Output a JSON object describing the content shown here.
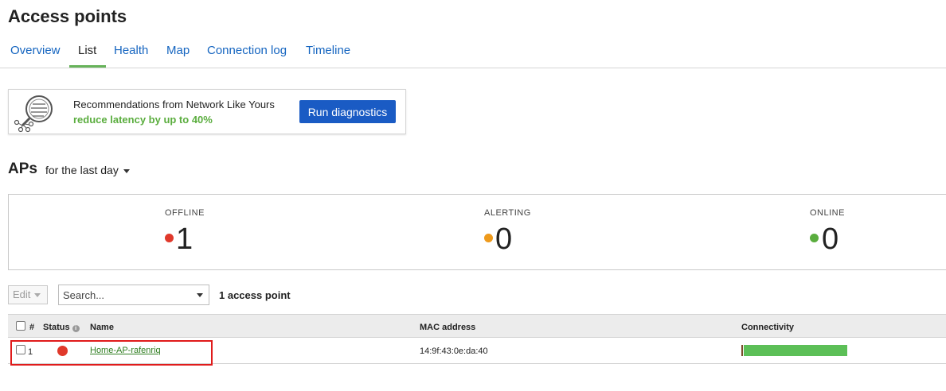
{
  "page": {
    "title": "Access points"
  },
  "tabs": [
    {
      "label": "Overview",
      "active": false
    },
    {
      "label": "List",
      "active": true
    },
    {
      "label": "Health",
      "active": false
    },
    {
      "label": "Map",
      "active": false
    },
    {
      "label": "Connection log",
      "active": false
    },
    {
      "label": "Timeline",
      "active": false
    }
  ],
  "recommendation": {
    "icon": "magnifier-network-icon",
    "line1": "Recommendations from Network Like Yours",
    "line2": "reduce latency by up to 40%",
    "button_label": "Run diagnostics"
  },
  "aps_section": {
    "title": "APs",
    "range_label": "for the last day"
  },
  "summary": [
    {
      "label": "OFFLINE",
      "value": "1",
      "color": "#e0392b"
    },
    {
      "label": "ALERTING",
      "value": "0",
      "color": "#ee9a1c"
    },
    {
      "label": "ONLINE",
      "value": "0",
      "color": "#5aad3e"
    }
  ],
  "toolbar": {
    "edit_label": "Edit",
    "search_placeholder": "Search...",
    "count_label": "1 access point"
  },
  "table": {
    "columns": {
      "index": "#",
      "status": "Status",
      "name": "Name",
      "mac": "MAC address",
      "connectivity": "Connectivity"
    },
    "rows": [
      {
        "index": "1",
        "status": "offline",
        "status_color": "#e0392b",
        "name": "Home-AP-rafenriq",
        "mac": "14:9f:43:0e:da:40",
        "connectivity_online_fraction": 0.98
      }
    ]
  }
}
